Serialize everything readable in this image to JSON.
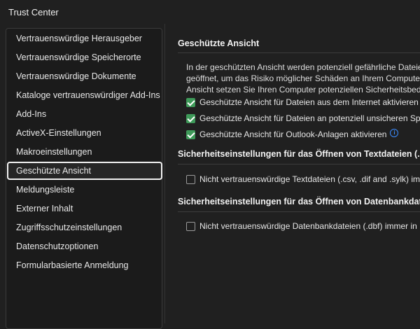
{
  "window": {
    "title": "Trust Center"
  },
  "sidebar": {
    "items": [
      {
        "label": "Vertrauenswürdige Herausgeber",
        "selected": false
      },
      {
        "label": "Vertrauenswürdige Speicherorte",
        "selected": false
      },
      {
        "label": "Vertrauenswürdige Dokumente",
        "selected": false
      },
      {
        "label": "Kataloge vertrauenswürdiger Add-Ins",
        "selected": false
      },
      {
        "label": "Add-Ins",
        "selected": false
      },
      {
        "label": "ActiveX-Einstellungen",
        "selected": false
      },
      {
        "label": "Makroeinstellungen",
        "selected": false
      },
      {
        "label": "Geschützte Ansicht",
        "selected": true
      },
      {
        "label": "Meldungsleiste",
        "selected": false
      },
      {
        "label": "Externer Inhalt",
        "selected": false
      },
      {
        "label": "Zugriffsschutzeinstellungen",
        "selected": false
      },
      {
        "label": "Datenschutzoptionen",
        "selected": false
      },
      {
        "label": "Formularbasierte Anmeldung",
        "selected": false
      }
    ]
  },
  "protected_view": {
    "title": "Geschützte Ansicht",
    "description": [
      "In der geschützten Ansicht werden potenziell gefährliche Dateien",
      "geöffnet, um das Risiko möglicher Schäden an Ihrem Computer",
      "Ansicht setzen Sie Ihren Computer potenziellen Sicherheitsbedr"
    ],
    "options": [
      {
        "label": "Geschützte Ansicht für Dateien aus dem Internet aktivieren",
        "checked": true
      },
      {
        "label": "Geschützte Ansicht für Dateien an potenziell unsicheren Spe",
        "checked": true
      },
      {
        "label": "Geschützte Ansicht für Outlook-Anlagen aktivieren",
        "checked": true
      }
    ]
  },
  "text_files": {
    "title": "Sicherheitseinstellungen für das Öffnen von Textdateien (.csv,",
    "option": {
      "label": "Nicht vertrauenswürdige Textdateien (.csv, .dif and .sylk) imm",
      "checked": false
    }
  },
  "database_files": {
    "title": "Sicherheitseinstellungen für das Öffnen von Datenbankdateien",
    "option": {
      "label": "Nicht vertrauenswürdige Datenbankdateien (.dbf) immer in",
      "checked": false
    }
  },
  "colors": {
    "background": "#202020",
    "checkbox_checked": "#3e9a59",
    "info_icon": "#3b8cff"
  }
}
